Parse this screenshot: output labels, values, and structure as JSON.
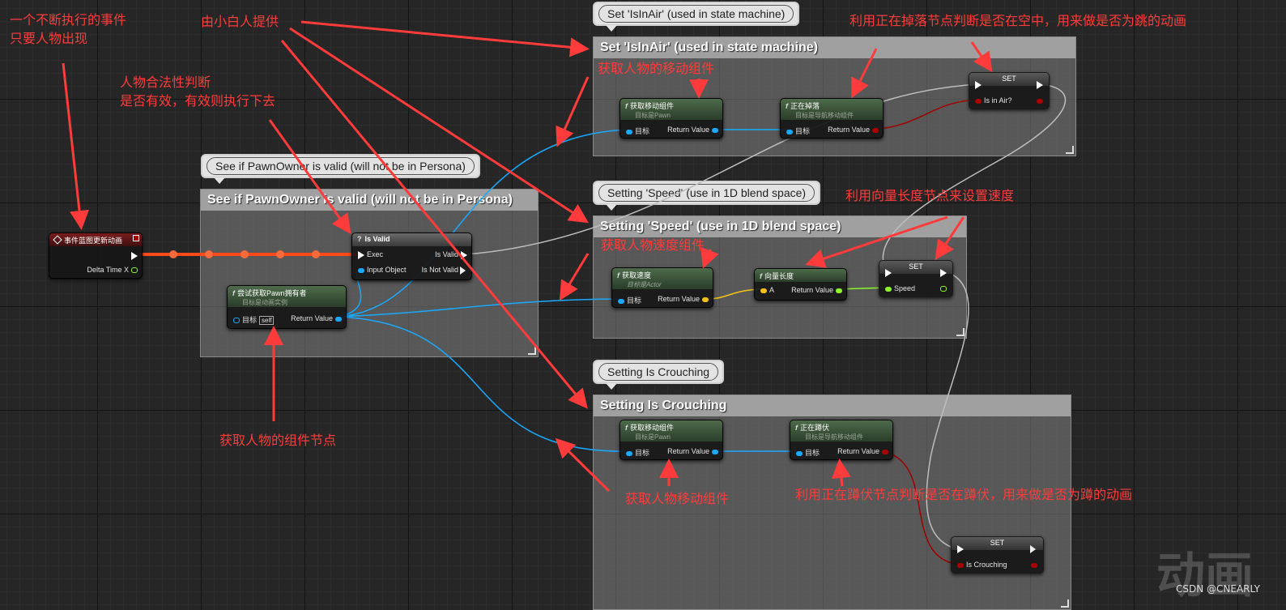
{
  "comments": {
    "pawn_valid": {
      "title": "See if PawnOwner is valid (will not be in Persona)",
      "bubble": "See if PawnOwner is valid (will not be in Persona)"
    },
    "in_air": {
      "title": "Set 'IsInAir' (used in state machine)",
      "bubble": "Set 'IsInAir' (used in state machine)"
    },
    "speed": {
      "title": "Setting 'Speed' (use in 1D blend space)",
      "bubble": "Setting 'Speed' (use in 1D blend space)"
    },
    "crouch": {
      "title": "Setting Is Crouching",
      "bubble": "Setting Is Crouching"
    }
  },
  "nodes": {
    "event": {
      "title": "事件蓝图更新动画",
      "pin_delta": "Delta Time X"
    },
    "is_valid": {
      "title": "Is Valid",
      "pin_exec": "Exec",
      "pin_input": "Input Object",
      "pin_valid": "Is Valid",
      "pin_not_valid": "Is Not Valid"
    },
    "try_get_pawn": {
      "title": "尝试获取Pawn拥有者",
      "sub": "目标是动画实例",
      "pin_target": "目标",
      "pin_self": "self",
      "pin_return": "Return Value"
    },
    "get_move_1": {
      "title": "获取移动组件",
      "sub": "目标是Pawn",
      "pin_target": "目标",
      "pin_return": "Return Value"
    },
    "is_falling": {
      "title": "正在掉落",
      "sub": "目标是导航移动组件",
      "pin_target": "目标",
      "pin_return": "Return Value"
    },
    "set_in_air": {
      "title": "SET",
      "pin_var": "Is in Air?"
    },
    "get_velocity": {
      "title": "获取速度",
      "sub": "目标是Actor",
      "pin_target": "目标",
      "pin_return": "Return Value"
    },
    "vector_length": {
      "title": "向量长度",
      "pin_a": "A",
      "pin_return": "Return Value"
    },
    "set_speed": {
      "title": "SET",
      "pin_var": "Speed"
    },
    "get_move_2": {
      "title": "获取移动组件",
      "sub": "目标是Pawn",
      "pin_target": "目标",
      "pin_return": "Return Value"
    },
    "is_crouching": {
      "title": "正在蹲伏",
      "sub": "目标是导航移动组件",
      "pin_target": "目标",
      "pin_return": "Return Value"
    },
    "set_crouch": {
      "title": "SET",
      "pin_var": "Is Crouching"
    }
  },
  "annotations": {
    "event_note_1": "一个不断执行的事件",
    "event_note_2": "只要人物出现",
    "provided": "由小白人提供",
    "valid_note_1": "人物合法性判断",
    "valid_note_2": "是否有效，有效则执行下去",
    "get_component": "获取人物的组件节点",
    "get_move": "获取人物的移动组件",
    "falling_note": "利用正在掉落节点判断是否在空中，用来做是否为跳的动画",
    "get_speed": "获取人物速度组件",
    "length_note": "利用向量长度节点来设置速度",
    "get_move_2": "获取人物移动组件",
    "crouch_note": "利用正在蹲伏节点判断是否在蹲伏，用来做是否为蹲的动画"
  },
  "watermark": "动画",
  "credit": "CSDN @CNEARLY",
  "colors": {
    "annotation": "#ff3b3b",
    "object_wire": "#19a9ff",
    "bool_wire": "#a00000",
    "float_wire": "#8df52e",
    "vector_wire": "#f2c314",
    "exec_wire_hot": "#ff4a1a"
  }
}
